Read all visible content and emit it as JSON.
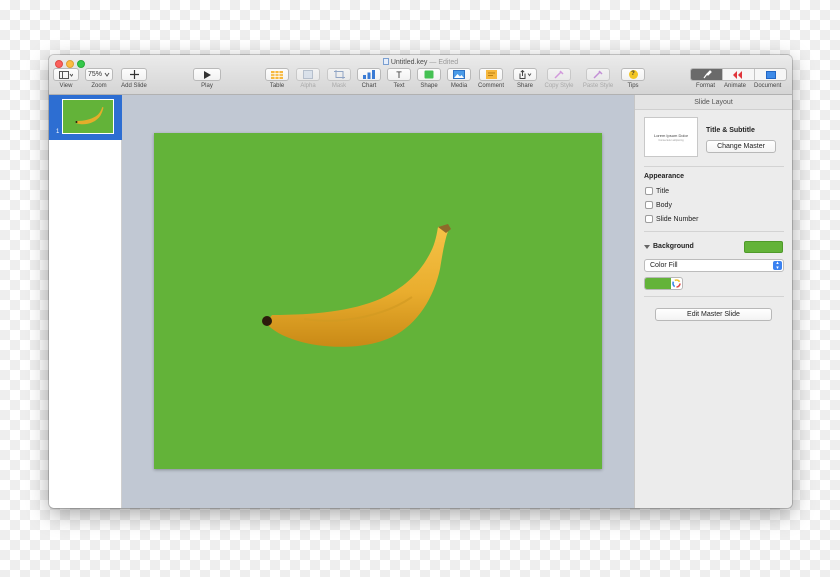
{
  "window": {
    "title": "Untitled.key",
    "status": "Edited"
  },
  "toolbar": {
    "view_label": "View",
    "zoom_value": "75%",
    "zoom_label": "Zoom",
    "add_slide_label": "Add Slide",
    "play_label": "Play",
    "items": [
      {
        "label": "Table",
        "icon": "table-icon",
        "enabled": true
      },
      {
        "label": "Alpha",
        "icon": "alpha-icon",
        "enabled": false
      },
      {
        "label": "Mask",
        "icon": "mask-icon",
        "enabled": false
      },
      {
        "label": "Chart",
        "icon": "chart-icon",
        "enabled": true
      },
      {
        "label": "Text",
        "icon": "text-icon",
        "enabled": true
      },
      {
        "label": "Shape",
        "icon": "shape-icon",
        "enabled": true
      },
      {
        "label": "Media",
        "icon": "media-icon",
        "enabled": true
      },
      {
        "label": "Comment",
        "icon": "comment-icon",
        "enabled": true
      },
      {
        "label": "Share",
        "icon": "share-icon",
        "enabled": true
      },
      {
        "label": "Copy Style",
        "icon": "copy-style-icon",
        "enabled": false
      },
      {
        "label": "Paste Style",
        "icon": "paste-style-icon",
        "enabled": false
      },
      {
        "label": "Tips",
        "icon": "tips-icon",
        "enabled": true
      }
    ],
    "text_glyph": "T",
    "tips_glyph": "?",
    "format_label": "Format",
    "animate_label": "Animate",
    "document_label": "Document"
  },
  "navigator": {
    "slides": [
      {
        "number": "1",
        "selected": true
      }
    ]
  },
  "slide": {
    "background_color": "#63b339"
  },
  "inspector": {
    "header": "Slide Layout",
    "master_name": "Title & Subtitle",
    "master_thumb_title": "Lorem Ipsum Dolor",
    "master_thumb_subtitle": "Consectetur adipiscing",
    "change_master_label": "Change Master",
    "appearance_title": "Appearance",
    "appearance_options": [
      {
        "label": "Title",
        "checked": false
      },
      {
        "label": "Body",
        "checked": false
      },
      {
        "label": "Slide Number",
        "checked": false
      }
    ],
    "background_title": "Background",
    "background_color": "#63b339",
    "fill_type": "Color Fill",
    "edit_master_label": "Edit Master Slide"
  },
  "colors": {
    "accent_blue": "#2d6ed2",
    "slide_green": "#63b339",
    "canvas_gray": "#c1c8d3"
  }
}
